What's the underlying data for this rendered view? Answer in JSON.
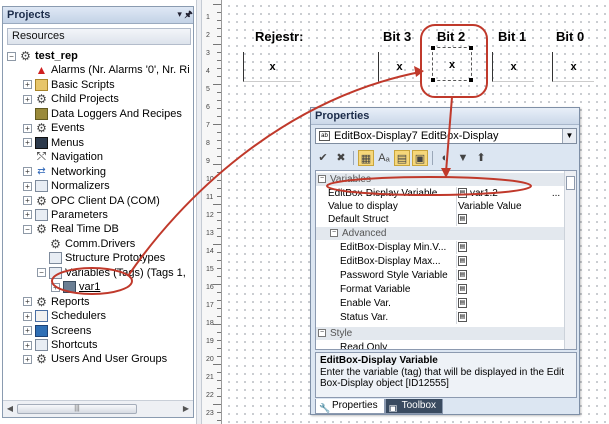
{
  "projects": {
    "title": "Projects",
    "pin_glyph": "▾ 🖈",
    "resources_label": "Resources",
    "tree": [
      {
        "label": "test_rep",
        "expander": "−",
        "icon": "gear",
        "depth": 0,
        "bold": true
      },
      {
        "label": "Alarms (Nr. Alarms '0', Nr. Ri",
        "expander": "",
        "icon": "alarm",
        "depth": 1
      },
      {
        "label": "Basic Scripts",
        "expander": "+",
        "icon": "folder",
        "depth": 1
      },
      {
        "label": "Child Projects",
        "expander": "+",
        "icon": "gear",
        "depth": 1
      },
      {
        "label": "Data Loggers And Recipes",
        "expander": "",
        "icon": "db",
        "depth": 1
      },
      {
        "label": "Events",
        "expander": "+",
        "icon": "gear",
        "depth": 1
      },
      {
        "label": "Menus",
        "expander": "+",
        "icon": "dark",
        "depth": 1
      },
      {
        "label": "Navigation",
        "expander": "",
        "icon": "nav",
        "depth": 1
      },
      {
        "label": "Networking",
        "expander": "+",
        "icon": "net",
        "depth": 1
      },
      {
        "label": "Normalizers",
        "expander": "+",
        "icon": "doc",
        "depth": 1
      },
      {
        "label": "OPC Client DA (COM)",
        "expander": "+",
        "icon": "gear",
        "depth": 1
      },
      {
        "label": "Parameters",
        "expander": "+",
        "icon": "doc",
        "depth": 1
      },
      {
        "label": "Real Time DB",
        "expander": "−",
        "icon": "gear",
        "depth": 1
      },
      {
        "label": "Comm.Drivers",
        "expander": "",
        "icon": "gear",
        "depth": 2
      },
      {
        "label": "Structure Prototypes",
        "expander": "",
        "icon": "doc",
        "depth": 2
      },
      {
        "label": "Variables (Tags) (Tags 1,",
        "expander": "−",
        "icon": "doc",
        "depth": 2
      },
      {
        "label": "var1",
        "expander": "+",
        "icon": "var",
        "depth": 3,
        "underline": true
      },
      {
        "label": "Reports",
        "expander": "+",
        "icon": "gear",
        "depth": 1
      },
      {
        "label": "Schedulers",
        "expander": "+",
        "icon": "cal",
        "depth": 1
      },
      {
        "label": "Screens",
        "expander": "+",
        "icon": "screen",
        "depth": 1
      },
      {
        "label": "Shortcuts",
        "expander": "+",
        "icon": "doc",
        "depth": 1
      },
      {
        "label": "Users And User Groups",
        "expander": "+",
        "icon": "gear",
        "depth": 1
      }
    ],
    "scroll_left": "◀",
    "scroll_right": "▶",
    "scroll_grip": "|||"
  },
  "canvas": {
    "labels": [
      "Rejestr:",
      "Bit 3",
      "Bit 2",
      "Bit 1",
      "Bit 0"
    ],
    "box_value": "x",
    "ruler_numbers": [
      "1",
      "2",
      "3",
      "4",
      "5",
      "6",
      "7",
      "8",
      "9",
      "10",
      "11",
      "12",
      "13",
      "14",
      "15",
      "16",
      "17",
      "18",
      "19",
      "20",
      "21",
      "22",
      "23"
    ]
  },
  "properties": {
    "title": "Properties",
    "object_select": "EditBox-Display7 EditBox-Display",
    "object_icon": "ab",
    "dropdown_glyph": "▼",
    "toolbar": [
      "✔",
      "✖",
      "▦",
      "Aₐ",
      "▤",
      "▣",
      "◐",
      "▼",
      "⬆"
    ],
    "categories": {
      "variables": "Variables",
      "advanced": "Advanced",
      "style": "Style"
    },
    "rows": [
      {
        "name": "EditBox-Display Variable",
        "value": "var1.2",
        "icon": true,
        "ellipsis": "..."
      },
      {
        "name": "Value to display",
        "value": "Variable Value",
        "icon": false
      },
      {
        "name": "Default Struct",
        "value": "",
        "icon": true
      }
    ],
    "advanced_rows": [
      {
        "name": "EditBox-Display Min.V...",
        "value": "",
        "icon": true
      },
      {
        "name": "EditBox-Display Max...",
        "value": "",
        "icon": true
      },
      {
        "name": "Password Style Variable",
        "value": "",
        "icon": true
      },
      {
        "name": "Format Variable",
        "value": "",
        "icon": true
      },
      {
        "name": "Enable Var.",
        "value": "",
        "icon": true
      },
      {
        "name": "Status Var.",
        "value": "",
        "icon": true
      }
    ],
    "style_partial": "Read Only",
    "description_title": "EditBox-Display Variable",
    "description_text": "Enter the variable (tag) that will be displayed in the Edit Box-Display object [ID12555]",
    "tabs": [
      {
        "label": "Properties",
        "active": true
      },
      {
        "label": "Toolbox",
        "active": false
      }
    ]
  },
  "colors": {
    "annotation": "#c0392b",
    "header_blue": "#c3d2e6",
    "panel_border": "#8a9bb0"
  }
}
